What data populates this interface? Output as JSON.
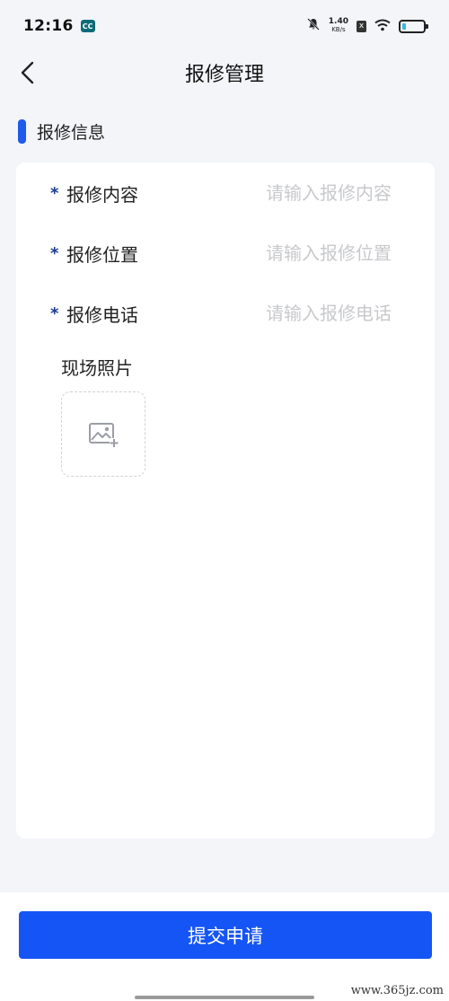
{
  "status_bar": {
    "time": "12:16",
    "app_badge": "CC",
    "net_speed_value": "1.40",
    "net_speed_unit": "KB/s",
    "sim_mark": "x",
    "battery_level": 0.2,
    "battery_color": "#37b8e0"
  },
  "nav": {
    "title": "报修管理",
    "back_icon": "chevron-left-icon"
  },
  "section": {
    "title": "报修信息",
    "marker_color": "#1e5bea"
  },
  "form": {
    "required_mark": "*",
    "fields": [
      {
        "label": "报修内容",
        "value": "",
        "placeholder": "请输入报修内容"
      },
      {
        "label": "报修位置",
        "value": "",
        "placeholder": "请输入报修位置"
      },
      {
        "label": "报修电话",
        "value": "",
        "placeholder": "请输入报修电话"
      }
    ],
    "photo_label": "现场照片",
    "photo_icon": "image-add-icon"
  },
  "submit": {
    "label": "提交申请",
    "color": "#1555f5"
  },
  "watermark": "www.365jz.com"
}
